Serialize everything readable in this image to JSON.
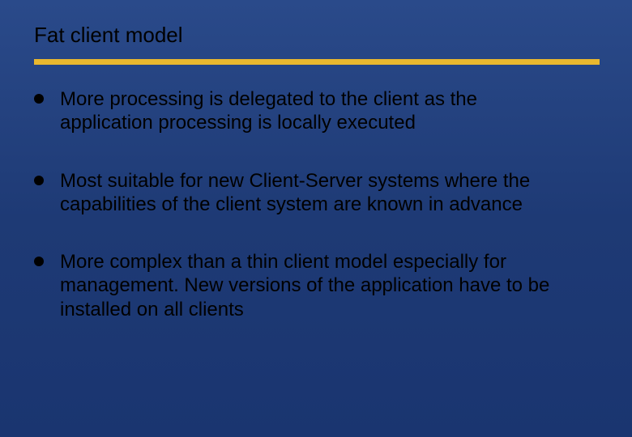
{
  "slide": {
    "title": "Fat client model",
    "bullets": [
      "More processing is delegated to the client as the application processing is locally executed",
      "Most suitable for new Client-Server systems where the capabilities of the client system are known in advance",
      "More complex than a thin client model especially for management. New versions of the application have to be installed on all clients"
    ]
  }
}
